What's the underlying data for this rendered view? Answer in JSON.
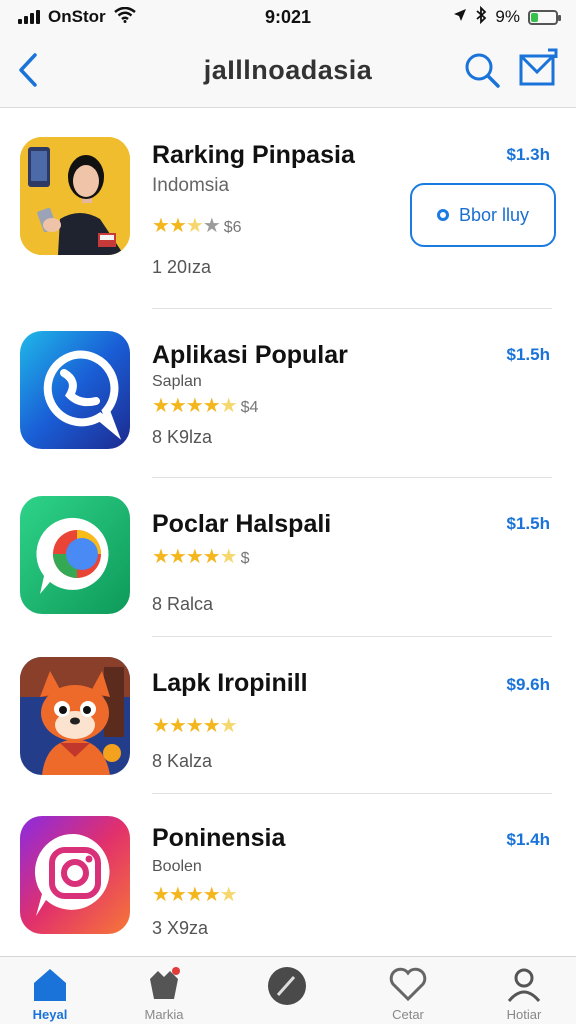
{
  "status_bar": {
    "carrier": "OnStor",
    "time": "9:021",
    "battery_text": "9%",
    "battery_level": 0.3
  },
  "nav": {
    "title": "jaIllnoadasia"
  },
  "apps": [
    {
      "name": "Rarking Pinpasia",
      "subtitle": "Indomsia",
      "rating": 2.5,
      "rating_text": "$6",
      "meta": "1 20ıza",
      "price": "$1.3h",
      "button_label": "Bbor lluy"
    },
    {
      "name": "Aplikasi Popular",
      "subtitle": "Saplan",
      "rating": 4.5,
      "rating_text": "$4",
      "meta": "8 K9lza",
      "price": "$1.5h"
    },
    {
      "name": "Poclar Halspali",
      "subtitle": "",
      "rating": 4.5,
      "rating_text": "$",
      "meta": "8 Ralca",
      "price": "$1.5h"
    },
    {
      "name": "Lapk Iropinill",
      "subtitle": "",
      "rating": 4.5,
      "rating_text": "",
      "meta": "8 Kalza",
      "price": "$9.6h"
    },
    {
      "name": "Poninensia",
      "subtitle": "Boolen",
      "rating": 4.5,
      "rating_text": "",
      "meta": "3 X9za",
      "price": "$1.4h"
    }
  ],
  "tabs": [
    {
      "label": "Heyal",
      "icon": "home-icon",
      "active": true
    },
    {
      "label": "Markia",
      "icon": "games-icon",
      "active": false
    },
    {
      "label": "",
      "icon": "compass-icon",
      "active": false
    },
    {
      "label": "Cetar",
      "icon": "heart-icon",
      "active": false
    },
    {
      "label": "Hotiar",
      "icon": "profile-icon",
      "active": false
    }
  ],
  "colors": {
    "accent": "#1a73d9",
    "star": "#f3b61d"
  }
}
